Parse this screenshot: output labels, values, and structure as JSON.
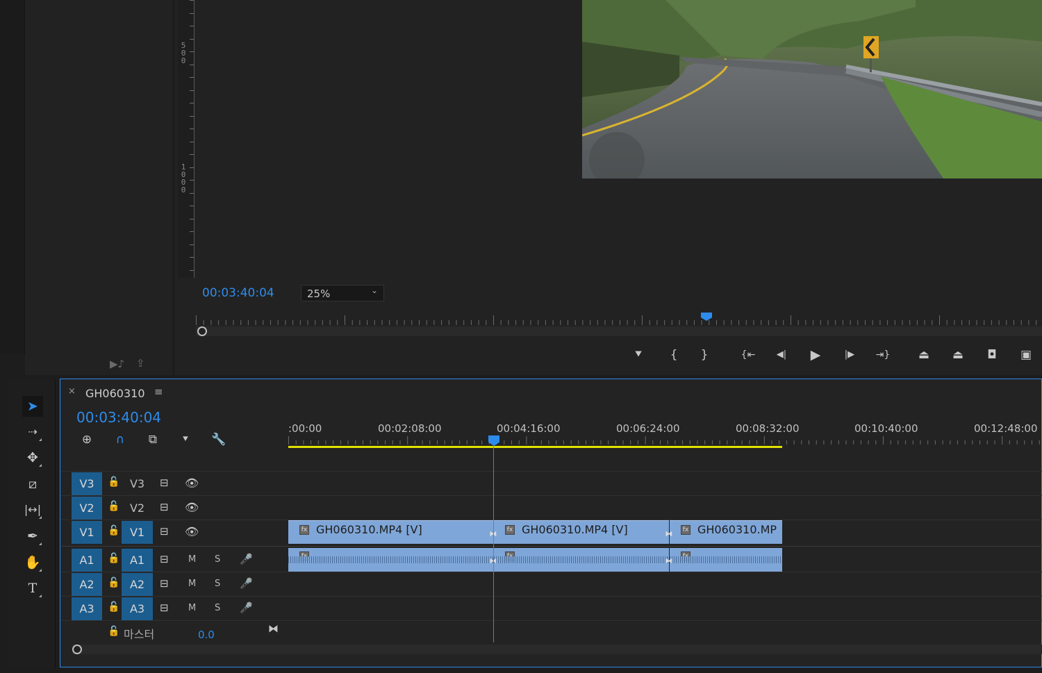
{
  "app": {
    "accent": "#2d8ceb",
    "track_target": "#1c5d8f",
    "clip_color": "#7fa6d8",
    "workarea_color": "#e0e000"
  },
  "left_panel": {
    "icons": [
      "audio-out-icon",
      "export-frame-icon"
    ]
  },
  "program_monitor": {
    "timecode": "00:03:40:04",
    "zoom": "25%",
    "vertical_ruler": [
      {
        "label": "5\n0\n0"
      },
      {
        "label": "1\n0\n0\n0"
      }
    ],
    "transport": [
      {
        "name": "add-marker-icon",
        "glyph": "⯆"
      },
      {
        "name": "mark-in-icon",
        "glyph": "{"
      },
      {
        "name": "mark-out-icon",
        "glyph": "}"
      },
      {
        "name": "go-to-in-icon",
        "glyph": "{⇤"
      },
      {
        "name": "step-back-icon",
        "glyph": "◀|"
      },
      {
        "name": "play-icon",
        "glyph": "▶"
      },
      {
        "name": "step-forward-icon",
        "glyph": "|▶"
      },
      {
        "name": "go-to-out-icon",
        "glyph": "⇥}"
      },
      {
        "name": "lift-icon",
        "glyph": "⏏"
      },
      {
        "name": "extract-icon",
        "glyph": "⏏"
      },
      {
        "name": "export-frame-icon",
        "glyph": "◘"
      },
      {
        "name": "compare-view-icon",
        "glyph": "▣"
      }
    ]
  },
  "timeline": {
    "sequence_name": "GH060310",
    "timecode": "00:03:40:04",
    "ruler_labels": [
      ":00:00",
      "00:02:08:00",
      "00:04:16:00",
      "00:06:24:00",
      "00:08:32:00",
      "00:10:40:00",
      "00:12:48:00"
    ],
    "header_buttons": [
      "nest-icon",
      "snap-magnet-icon",
      "linked-selection-icon",
      "add-marker-icon",
      "wrench-icon"
    ],
    "tracks": [
      {
        "id": "V3",
        "target": "V3",
        "src": "V3",
        "src_on": false,
        "type": "video"
      },
      {
        "id": "V2",
        "target": "V2",
        "src": "V2",
        "src_on": false,
        "type": "video"
      },
      {
        "id": "V1",
        "target": "V1",
        "src": "V1",
        "src_on": true,
        "type": "video"
      },
      {
        "id": "A1",
        "target": "A1",
        "src": "A1",
        "src_on": true,
        "type": "audio",
        "m": "M",
        "s": "S"
      },
      {
        "id": "A2",
        "target": "A2",
        "src": "A2",
        "src_on": true,
        "type": "audio",
        "m": "M",
        "s": "S"
      },
      {
        "id": "A3",
        "target": "A3",
        "src": "A3",
        "src_on": true,
        "type": "audio",
        "m": "M",
        "s": "S"
      }
    ],
    "video_clips": [
      {
        "label": "GH060310.MP4 [V]"
      },
      {
        "label": "GH060310.MP4 [V]"
      },
      {
        "label": "GH060310.MP"
      }
    ],
    "master": {
      "label": "마스터",
      "value": "0.0"
    }
  },
  "tools": [
    "selection-tool-icon",
    "track-select-tool-icon",
    "ripple-edit-tool-icon",
    "razor-tool-icon",
    "slip-tool-icon",
    "pen-tool-icon",
    "hand-tool-icon",
    "type-tool-icon"
  ]
}
